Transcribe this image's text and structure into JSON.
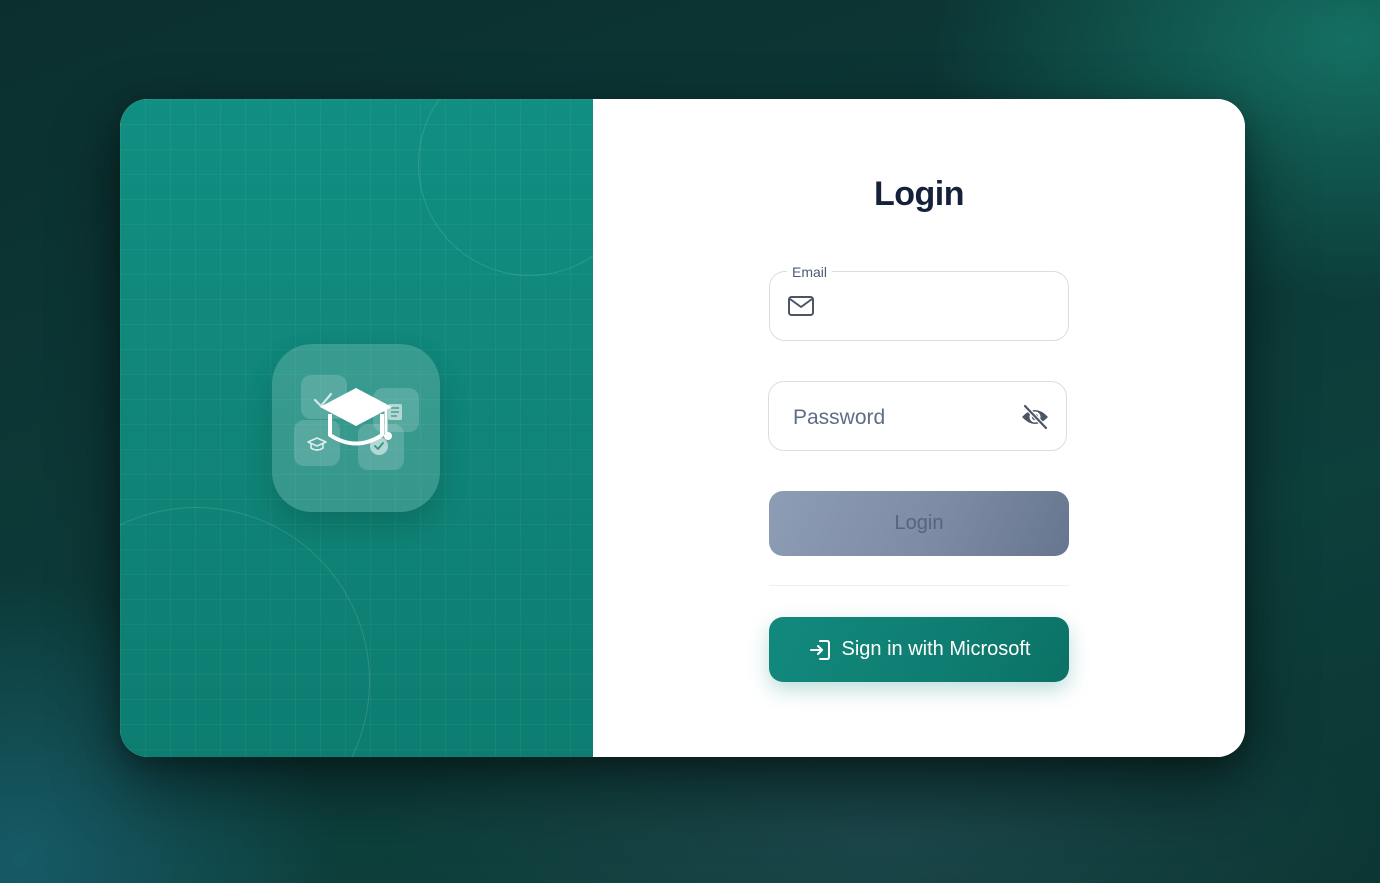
{
  "login_form": {
    "title": "Login",
    "email": {
      "label": "Email",
      "value": "",
      "icon": "mail-icon"
    },
    "password": {
      "placeholder": "Password",
      "value": "",
      "icon": "eye-off-icon"
    },
    "login_button_label": "Login",
    "microsoft_button": {
      "label": "Sign in with Microsoft",
      "icon": "sign-in-icon"
    }
  },
  "brand": {
    "icon": "graduation-cap-icon"
  },
  "colors": {
    "brand_teal": "#118f82",
    "title_navy": "#15203a",
    "disabled_button": "#8e9db6",
    "microsoft_button": "#12897d"
  }
}
